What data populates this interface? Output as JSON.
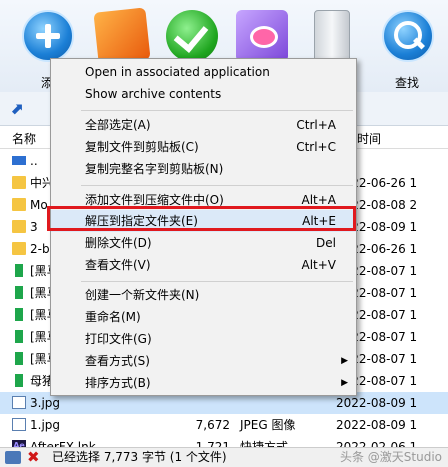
{
  "toolbar": {
    "items": [
      {
        "label": "添",
        "icon": "add-icon"
      },
      {
        "label": "",
        "icon": "extract-icon"
      },
      {
        "label": "",
        "icon": "test-icon"
      },
      {
        "label": "",
        "icon": "view-icon"
      },
      {
        "label": "",
        "icon": "delete-icon"
      },
      {
        "label": "查找",
        "icon": "find-icon"
      }
    ]
  },
  "address_bar": {
    "up_icon": "up-arrow-icon"
  },
  "list": {
    "headers": {
      "name": "名称",
      "date": "时间"
    },
    "rows": [
      {
        "name": "..",
        "size": "",
        "type": "",
        "date": "",
        "icon": "parent-folder-icon"
      },
      {
        "name": "中兴",
        "size": "",
        "type": "",
        "date": "2022-06-26 1",
        "icon": "folder-icon"
      },
      {
        "name": "Mo",
        "size": "",
        "type": "",
        "date": "2022-08-08 2",
        "icon": "folder-icon"
      },
      {
        "name": "3",
        "size": "",
        "type": "",
        "date": "2022-08-09 1",
        "icon": "folder-icon"
      },
      {
        "name": "2-b",
        "size": "",
        "type": "",
        "date": "2022-06-26 1",
        "icon": "folder-icon"
      },
      {
        "name": "[黑马",
        "size": "",
        "type": "",
        "date": "2022-08-07 1",
        "icon": "green-file-icon"
      },
      {
        "name": "[黑马",
        "size": "",
        "type": "",
        "date": "2022-08-07 1",
        "icon": "green-file-icon"
      },
      {
        "name": "[黑马",
        "size": "",
        "type": "",
        "date": "2022-08-07 1",
        "icon": "green-file-icon"
      },
      {
        "name": "[黑马",
        "size": "",
        "type": "",
        "date": "2022-08-07 1",
        "icon": "green-file-icon"
      },
      {
        "name": "[黑马",
        "size": "",
        "type": "",
        "date": "2022-08-07 1",
        "icon": "green-file-icon"
      },
      {
        "name": "母猪",
        "size": "",
        "type": "",
        "date": "2022-08-07 1",
        "icon": "green-file-icon"
      },
      {
        "name": "3.jpg",
        "size": "",
        "type": "",
        "date": "2022-08-09 1",
        "icon": "image-file-icon",
        "selected": true
      },
      {
        "name": "1.jpg",
        "size": "7,672",
        "type": "JPEG 图像",
        "date": "2022-08-09 1",
        "icon": "image-file-icon"
      },
      {
        "name": "AfterFX.lnk",
        "size": "1,721",
        "type": "快捷方式",
        "date": "2022-02-06 1",
        "icon": "ae-file-icon"
      }
    ]
  },
  "status": {
    "text": "已经选择 7,773 字节 (1 个文件)",
    "watermark": "头条 @激天Studio"
  },
  "context_menu": {
    "groups": [
      [
        {
          "label": "Open in associated application",
          "shortcut": ""
        },
        {
          "label": "Show archive contents",
          "shortcut": ""
        }
      ],
      [
        {
          "label": "全部选定(A)",
          "shortcut": "Ctrl+A"
        },
        {
          "label": "复制文件到剪贴板(C)",
          "shortcut": "Ctrl+C"
        },
        {
          "label": "复制完整名字到剪贴板(N)",
          "shortcut": ""
        }
      ],
      [
        {
          "label": "添加文件到压缩文件中(O)",
          "shortcut": "Alt+A"
        },
        {
          "label": "解压到指定文件夹(E)",
          "shortcut": "Alt+E",
          "highlighted": true
        },
        {
          "label": "删除文件(D)",
          "shortcut": "Del"
        },
        {
          "label": "查看文件(V)",
          "shortcut": "Alt+V"
        }
      ],
      [
        {
          "label": "创建一个新文件夹(N)",
          "shortcut": ""
        },
        {
          "label": "重命名(M)",
          "shortcut": ""
        },
        {
          "label": "打印文件(G)",
          "shortcut": ""
        },
        {
          "label": "查看方式(S)",
          "shortcut": "",
          "submenu": true
        },
        {
          "label": "排序方式(B)",
          "shortcut": "",
          "submenu": true
        }
      ]
    ]
  }
}
